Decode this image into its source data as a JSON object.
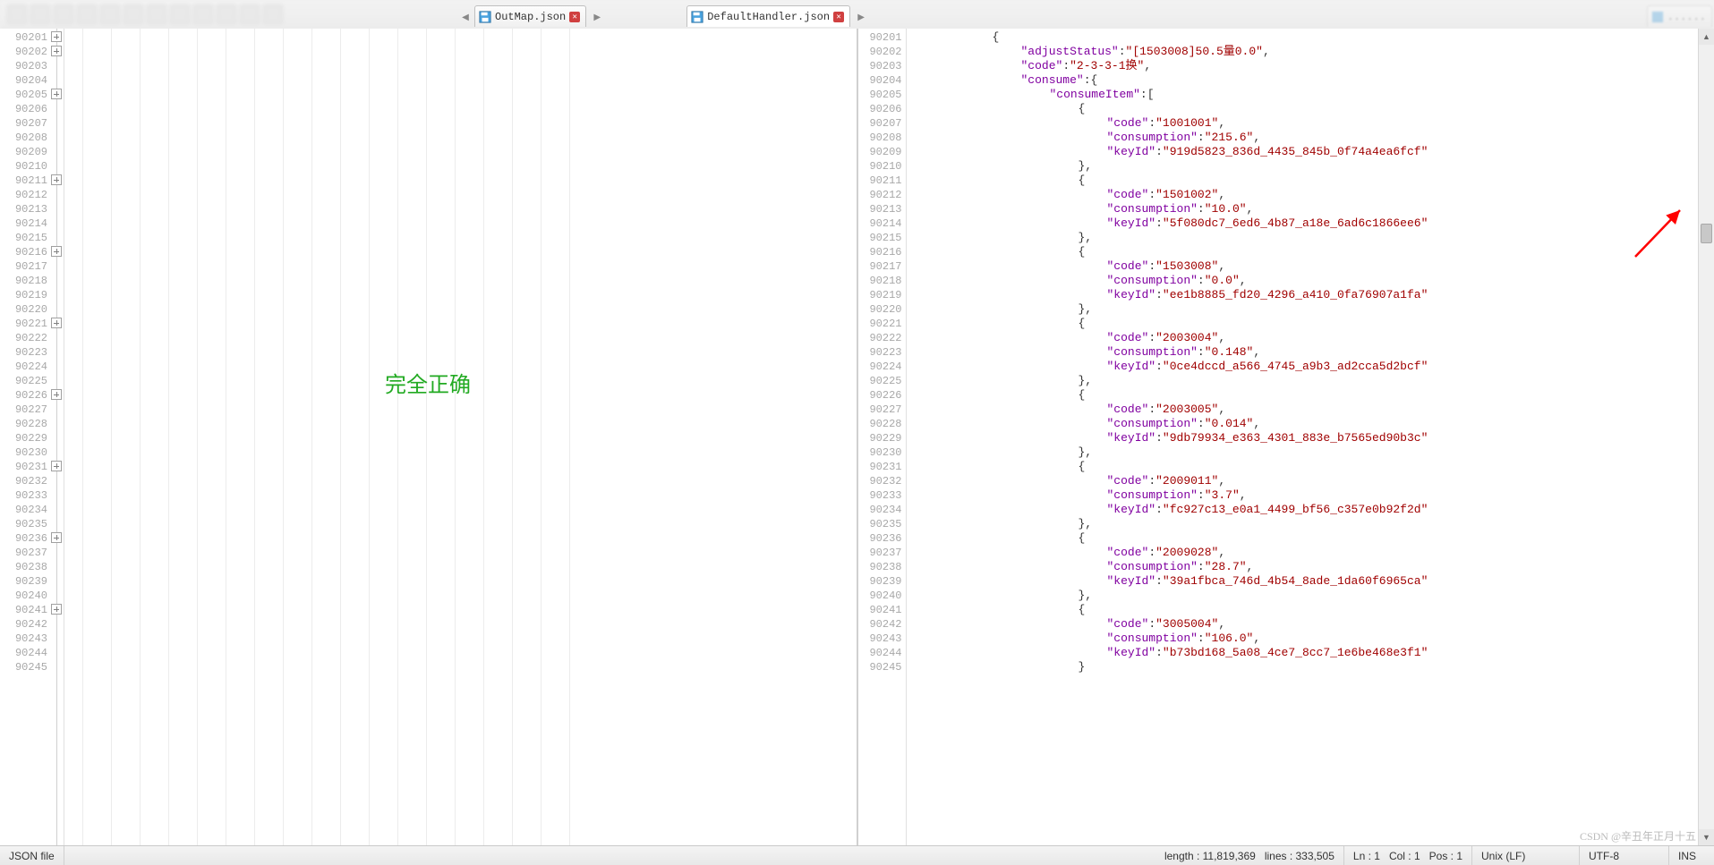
{
  "tabs": {
    "left": {
      "label": "OutMap.json"
    },
    "right": {
      "label": "DefaultHandler.json"
    }
  },
  "left_pane": {
    "line_start": 90201,
    "line_end": 90245,
    "overlay_text": "完全正确",
    "fold_lines_relative": [
      0,
      1,
      4,
      10,
      15,
      20,
      25,
      30,
      35,
      40
    ]
  },
  "right_pane": {
    "code": [
      {
        "indent": 3,
        "tokens": [
          [
            "punc",
            "{"
          ]
        ]
      },
      {
        "indent": 4,
        "tokens": [
          [
            "key",
            "\"adjustStatus\""
          ],
          [
            "punc",
            ":"
          ],
          [
            "str",
            "\"[1503008]50.5量0.0\""
          ],
          [
            "punc",
            ","
          ]
        ]
      },
      {
        "indent": 4,
        "tokens": [
          [
            "key",
            "\"code\""
          ],
          [
            "punc",
            ":"
          ],
          [
            "str",
            "\"2-3-3-1换\""
          ],
          [
            "punc",
            ","
          ]
        ]
      },
      {
        "indent": 4,
        "tokens": [
          [
            "key",
            "\"consume\""
          ],
          [
            "punc",
            ":{"
          ]
        ]
      },
      {
        "indent": 5,
        "tokens": [
          [
            "key",
            "\"consumeItem\""
          ],
          [
            "punc",
            ":["
          ]
        ]
      },
      {
        "indent": 6,
        "tokens": [
          [
            "punc",
            "{"
          ]
        ]
      },
      {
        "indent": 7,
        "tokens": [
          [
            "key",
            "\"code\""
          ],
          [
            "punc",
            ":"
          ],
          [
            "str",
            "\"1001001\""
          ],
          [
            "punc",
            ","
          ]
        ]
      },
      {
        "indent": 7,
        "tokens": [
          [
            "key",
            "\"consumption\""
          ],
          [
            "punc",
            ":"
          ],
          [
            "str",
            "\"215.6\""
          ],
          [
            "punc",
            ","
          ]
        ]
      },
      {
        "indent": 7,
        "tokens": [
          [
            "key",
            "\"keyId\""
          ],
          [
            "punc",
            ":"
          ],
          [
            "str",
            "\"919d5823_836d_4435_845b_0f74a4ea6fcf\""
          ]
        ]
      },
      {
        "indent": 6,
        "tokens": [
          [
            "punc",
            "},"
          ]
        ]
      },
      {
        "indent": 6,
        "tokens": [
          [
            "punc",
            "{"
          ]
        ]
      },
      {
        "indent": 7,
        "tokens": [
          [
            "key",
            "\"code\""
          ],
          [
            "punc",
            ":"
          ],
          [
            "str",
            "\"1501002\""
          ],
          [
            "punc",
            ","
          ]
        ]
      },
      {
        "indent": 7,
        "tokens": [
          [
            "key",
            "\"consumption\""
          ],
          [
            "punc",
            ":"
          ],
          [
            "str",
            "\"10.0\""
          ],
          [
            "punc",
            ","
          ]
        ]
      },
      {
        "indent": 7,
        "tokens": [
          [
            "key",
            "\"keyId\""
          ],
          [
            "punc",
            ":"
          ],
          [
            "str",
            "\"5f080dc7_6ed6_4b87_a18e_6ad6c1866ee6\""
          ]
        ]
      },
      {
        "indent": 6,
        "tokens": [
          [
            "punc",
            "},"
          ]
        ]
      },
      {
        "indent": 6,
        "tokens": [
          [
            "punc",
            "{"
          ]
        ]
      },
      {
        "indent": 7,
        "tokens": [
          [
            "key",
            "\"code\""
          ],
          [
            "punc",
            ":"
          ],
          [
            "str",
            "\"1503008\""
          ],
          [
            "punc",
            ","
          ]
        ]
      },
      {
        "indent": 7,
        "tokens": [
          [
            "key",
            "\"consumption\""
          ],
          [
            "punc",
            ":"
          ],
          [
            "str",
            "\"0.0\""
          ],
          [
            "punc",
            ","
          ]
        ]
      },
      {
        "indent": 7,
        "tokens": [
          [
            "key",
            "\"keyId\""
          ],
          [
            "punc",
            ":"
          ],
          [
            "str",
            "\"ee1b8885_fd20_4296_a410_0fa76907a1fa\""
          ]
        ]
      },
      {
        "indent": 6,
        "tokens": [
          [
            "punc",
            "},"
          ]
        ]
      },
      {
        "indent": 6,
        "tokens": [
          [
            "punc",
            "{"
          ]
        ]
      },
      {
        "indent": 7,
        "tokens": [
          [
            "key",
            "\"code\""
          ],
          [
            "punc",
            ":"
          ],
          [
            "str",
            "\"2003004\""
          ],
          [
            "punc",
            ","
          ]
        ]
      },
      {
        "indent": 7,
        "tokens": [
          [
            "key",
            "\"consumption\""
          ],
          [
            "punc",
            ":"
          ],
          [
            "str",
            "\"0.148\""
          ],
          [
            "punc",
            ","
          ]
        ]
      },
      {
        "indent": 7,
        "tokens": [
          [
            "key",
            "\"keyId\""
          ],
          [
            "punc",
            ":"
          ],
          [
            "str",
            "\"0ce4dccd_a566_4745_a9b3_ad2cca5d2bcf\""
          ]
        ]
      },
      {
        "indent": 6,
        "tokens": [
          [
            "punc",
            "},"
          ]
        ]
      },
      {
        "indent": 6,
        "tokens": [
          [
            "punc",
            "{"
          ]
        ]
      },
      {
        "indent": 7,
        "tokens": [
          [
            "key",
            "\"code\""
          ],
          [
            "punc",
            ":"
          ],
          [
            "str",
            "\"2003005\""
          ],
          [
            "punc",
            ","
          ]
        ]
      },
      {
        "indent": 7,
        "tokens": [
          [
            "key",
            "\"consumption\""
          ],
          [
            "punc",
            ":"
          ],
          [
            "str",
            "\"0.014\""
          ],
          [
            "punc",
            ","
          ]
        ]
      },
      {
        "indent": 7,
        "tokens": [
          [
            "key",
            "\"keyId\""
          ],
          [
            "punc",
            ":"
          ],
          [
            "str",
            "\"9db79934_e363_4301_883e_b7565ed90b3c\""
          ]
        ]
      },
      {
        "indent": 6,
        "tokens": [
          [
            "punc",
            "},"
          ]
        ]
      },
      {
        "indent": 6,
        "tokens": [
          [
            "punc",
            "{"
          ]
        ]
      },
      {
        "indent": 7,
        "tokens": [
          [
            "key",
            "\"code\""
          ],
          [
            "punc",
            ":"
          ],
          [
            "str",
            "\"2009011\""
          ],
          [
            "punc",
            ","
          ]
        ]
      },
      {
        "indent": 7,
        "tokens": [
          [
            "key",
            "\"consumption\""
          ],
          [
            "punc",
            ":"
          ],
          [
            "str",
            "\"3.7\""
          ],
          [
            "punc",
            ","
          ]
        ]
      },
      {
        "indent": 7,
        "tokens": [
          [
            "key",
            "\"keyId\""
          ],
          [
            "punc",
            ":"
          ],
          [
            "str",
            "\"fc927c13_e0a1_4499_bf56_c357e0b92f2d\""
          ]
        ]
      },
      {
        "indent": 6,
        "tokens": [
          [
            "punc",
            "},"
          ]
        ]
      },
      {
        "indent": 6,
        "tokens": [
          [
            "punc",
            "{"
          ]
        ]
      },
      {
        "indent": 7,
        "tokens": [
          [
            "key",
            "\"code\""
          ],
          [
            "punc",
            ":"
          ],
          [
            "str",
            "\"2009028\""
          ],
          [
            "punc",
            ","
          ]
        ]
      },
      {
        "indent": 7,
        "tokens": [
          [
            "key",
            "\"consumption\""
          ],
          [
            "punc",
            ":"
          ],
          [
            "str",
            "\"28.7\""
          ],
          [
            "punc",
            ","
          ]
        ]
      },
      {
        "indent": 7,
        "tokens": [
          [
            "key",
            "\"keyId\""
          ],
          [
            "punc",
            ":"
          ],
          [
            "str",
            "\"39a1fbca_746d_4b54_8ade_1da60f6965ca\""
          ]
        ]
      },
      {
        "indent": 6,
        "tokens": [
          [
            "punc",
            "},"
          ]
        ]
      },
      {
        "indent": 6,
        "tokens": [
          [
            "punc",
            "{"
          ]
        ]
      },
      {
        "indent": 7,
        "tokens": [
          [
            "key",
            "\"code\""
          ],
          [
            "punc",
            ":"
          ],
          [
            "str",
            "\"3005004\""
          ],
          [
            "punc",
            ","
          ]
        ]
      },
      {
        "indent": 7,
        "tokens": [
          [
            "key",
            "\"consumption\""
          ],
          [
            "punc",
            ":"
          ],
          [
            "str",
            "\"106.0\""
          ],
          [
            "punc",
            ","
          ]
        ]
      },
      {
        "indent": 7,
        "tokens": [
          [
            "key",
            "\"keyId\""
          ],
          [
            "punc",
            ":"
          ],
          [
            "str",
            "\"b73bd168_5a08_4ce7_8cc7_1e6be468e3f1\""
          ]
        ]
      },
      {
        "indent": 6,
        "tokens": [
          [
            "punc",
            "}"
          ]
        ]
      }
    ]
  },
  "statusbar": {
    "filetype": "JSON file",
    "length_label": "length : 11,819,369",
    "lines_label": "lines : 333,505",
    "ln_label": "Ln : 1",
    "col_label": "Col : 1",
    "pos_label": "Pos : 1",
    "eol": "Unix (LF)",
    "encoding": "UTF-8",
    "ins": "INS"
  },
  "watermark": "CSDN @辛丑年正月十五"
}
